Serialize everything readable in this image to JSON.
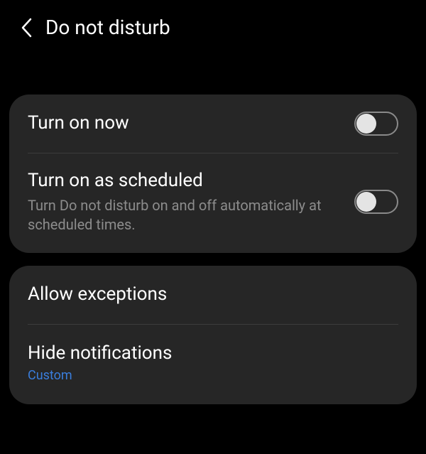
{
  "header": {
    "title": "Do not disturb"
  },
  "card1": {
    "turn_on_now": {
      "label": "Turn on now",
      "toggled": false
    },
    "scheduled": {
      "label": "Turn on as scheduled",
      "sublabel": "Turn Do not disturb on and off automatically at scheduled times.",
      "toggled": false
    }
  },
  "card2": {
    "allow_exceptions": {
      "label": "Allow exceptions"
    },
    "hide_notifications": {
      "label": "Hide notifications",
      "value": "Custom"
    }
  }
}
